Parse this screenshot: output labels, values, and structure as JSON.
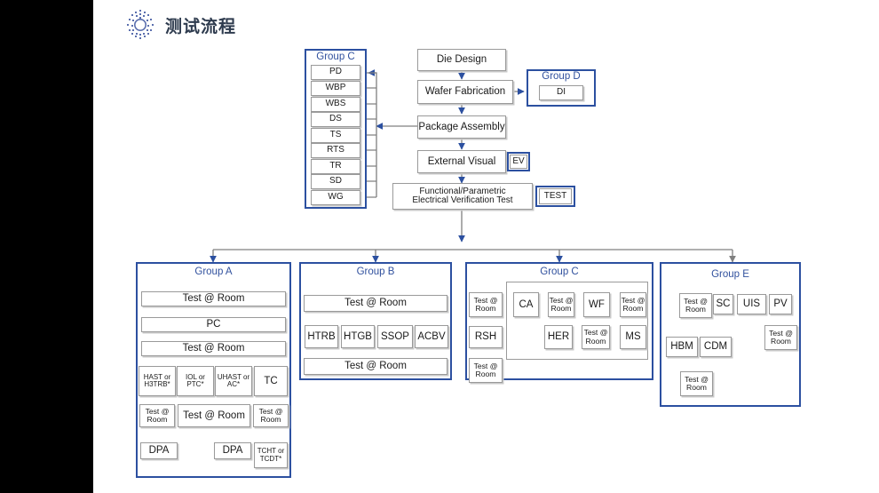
{
  "page": {
    "title": "测试流程",
    "logo_icon": "radial-dots-logo",
    "sidebar_color": "#000000",
    "accent_blue": "#2c50a0",
    "label_blue": "#31519e",
    "box_border": "#9a9a9a",
    "arrow_color": "#2c50a0",
    "connector_gray": "#808080"
  },
  "main_flow": {
    "nodes": [
      {
        "id": "die_design",
        "label": "Die Design"
      },
      {
        "id": "wafer_fab",
        "label": "Wafer Fabrication"
      },
      {
        "id": "pkg_assembly",
        "label": "Package Assembly"
      },
      {
        "id": "ext_visual",
        "label": "External Visual"
      },
      {
        "id": "func_test",
        "label": "Functional/Parametric\nElectrical Verification Test"
      }
    ],
    "tags": [
      {
        "id": "ev",
        "label": "EV"
      },
      {
        "id": "test",
        "label": "TEST"
      }
    ]
  },
  "group_c_top": {
    "label": "Group C",
    "items": [
      "PD",
      "WBP",
      "WBS",
      "DS",
      "TS",
      "RTS",
      "TR",
      "SD",
      "WG"
    ]
  },
  "group_d": {
    "label": "Group D",
    "items": [
      "DI"
    ]
  },
  "group_a": {
    "label": "Group A",
    "row1": [
      "Test @ Room"
    ],
    "row2": [
      "PC"
    ],
    "row3": [
      "Test @ Room"
    ],
    "stress_row": [
      "HAST or\nH3TRB*",
      "IOL or\nPTC*",
      "UHAST or\nAC*",
      "TC"
    ],
    "post_row": [
      "Test @\nRoom",
      "Test @ Room",
      "Test @\nRoom"
    ],
    "final_row": [
      "DPA",
      "DPA",
      "TCHT or\nTCDT*"
    ]
  },
  "group_b": {
    "label": "Group B",
    "top": "Test @ Room",
    "stress_row": [
      "HTRB",
      "HTGB",
      "SSOP",
      "ACBV"
    ],
    "bottom": "Test @ Room"
  },
  "group_c_bottom": {
    "label": "Group C",
    "left_chain": [
      "Test @\nRoom",
      "RSH",
      "Test @\nRoom"
    ],
    "upper_chain": [
      "CA",
      "Test @\nRoom",
      "WF",
      "Test @\nRoom"
    ],
    "lower_chain": [
      "MS",
      "Test @\nRoom",
      "HER"
    ]
  },
  "group_e": {
    "label": "Group E",
    "top_row": [
      "Test @\nRoom",
      "SC",
      "UIS",
      "PV"
    ],
    "esd_row": [
      "HBM",
      "CDM"
    ],
    "esd_post": "Test @\nRoom",
    "pv_post": "Test @\nRoom"
  }
}
